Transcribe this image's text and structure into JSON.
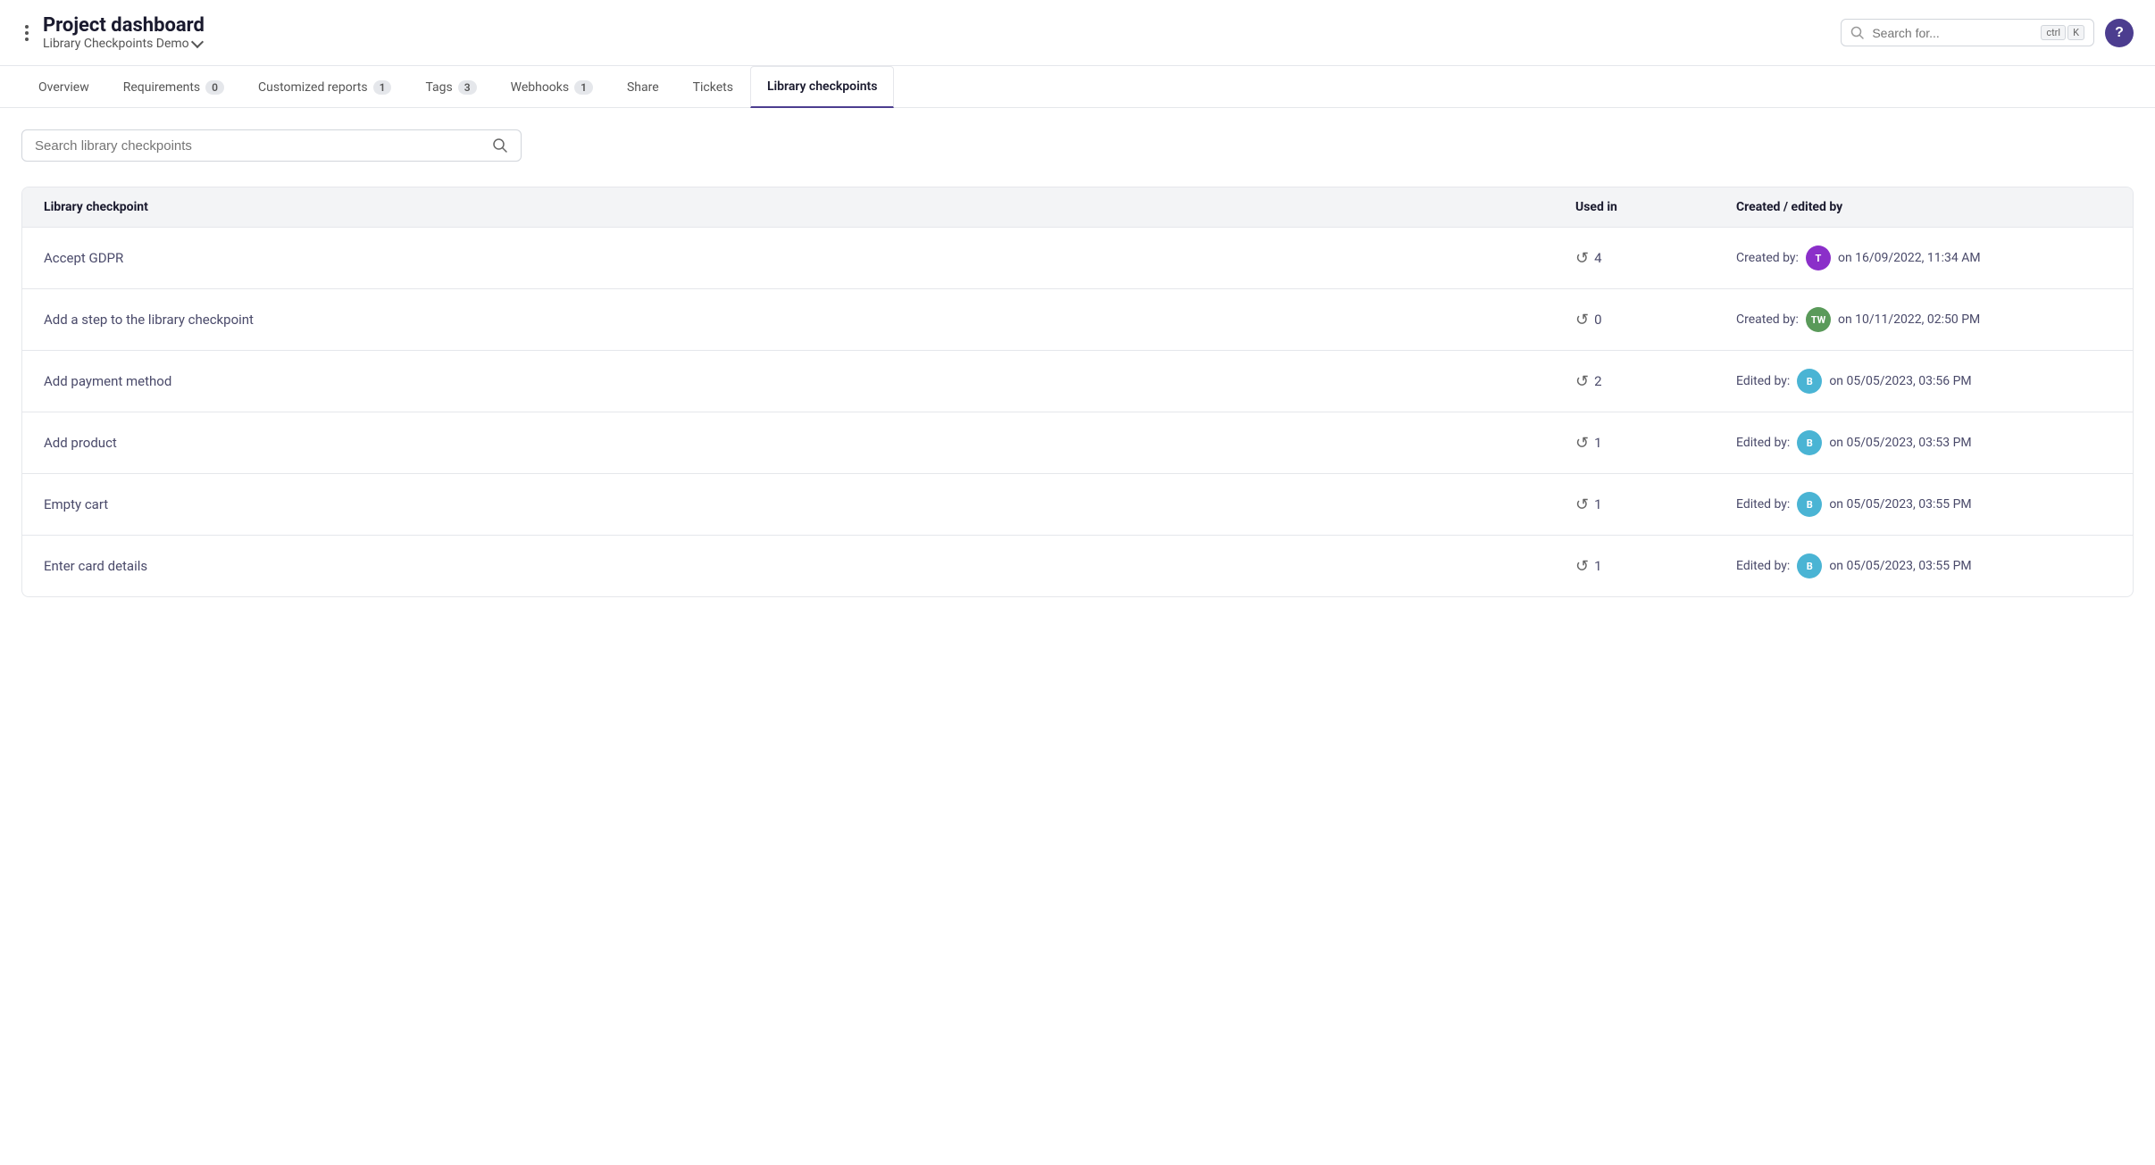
{
  "header": {
    "title": "Project dashboard",
    "subtitle": "Library Checkpoints Demo",
    "search_placeholder": "Search for...",
    "kbd1": "ctrl",
    "kbd2": "K",
    "help_label": "?"
  },
  "tabs": [
    {
      "id": "overview",
      "label": "Overview",
      "badge": null,
      "active": false
    },
    {
      "id": "requirements",
      "label": "Requirements",
      "badge": "0",
      "active": false
    },
    {
      "id": "customized-reports",
      "label": "Customized reports",
      "badge": "1",
      "active": false
    },
    {
      "id": "tags",
      "label": "Tags",
      "badge": "3",
      "active": false
    },
    {
      "id": "webhooks",
      "label": "Webhooks",
      "badge": "1",
      "active": false
    },
    {
      "id": "share",
      "label": "Share",
      "badge": null,
      "active": false
    },
    {
      "id": "tickets",
      "label": "Tickets",
      "badge": null,
      "active": false
    },
    {
      "id": "library-checkpoints",
      "label": "Library checkpoints",
      "badge": null,
      "active": true
    }
  ],
  "search": {
    "placeholder": "Search library checkpoints"
  },
  "table": {
    "columns": [
      "Library checkpoint",
      "Used in",
      "Created / edited by"
    ],
    "rows": [
      {
        "name": "Accept GDPR",
        "used_in": 4,
        "action": "Created by:",
        "avatar_initials": "T",
        "avatar_color": "purple",
        "date": "on 16/09/2022, 11:34 AM"
      },
      {
        "name": "Add a step to the library checkpoint",
        "used_in": 0,
        "action": "Created by:",
        "avatar_initials": "TW",
        "avatar_color": "green",
        "date": "on 10/11/2022, 02:50 PM"
      },
      {
        "name": "Add payment method",
        "used_in": 2,
        "action": "Edited by:",
        "avatar_initials": "B",
        "avatar_color": "blue",
        "date": "on 05/05/2023, 03:56 PM"
      },
      {
        "name": "Add product",
        "used_in": 1,
        "action": "Edited by:",
        "avatar_initials": "B",
        "avatar_color": "blue",
        "date": "on 05/05/2023, 03:53 PM"
      },
      {
        "name": "Empty cart",
        "used_in": 1,
        "action": "Edited by:",
        "avatar_initials": "B",
        "avatar_color": "blue",
        "date": "on 05/05/2023, 03:55 PM"
      },
      {
        "name": "Enter card details",
        "used_in": 1,
        "action": "Edited by:",
        "avatar_initials": "B",
        "avatar_color": "blue",
        "date": "on 05/05/2023, 03:55 PM"
      }
    ]
  }
}
